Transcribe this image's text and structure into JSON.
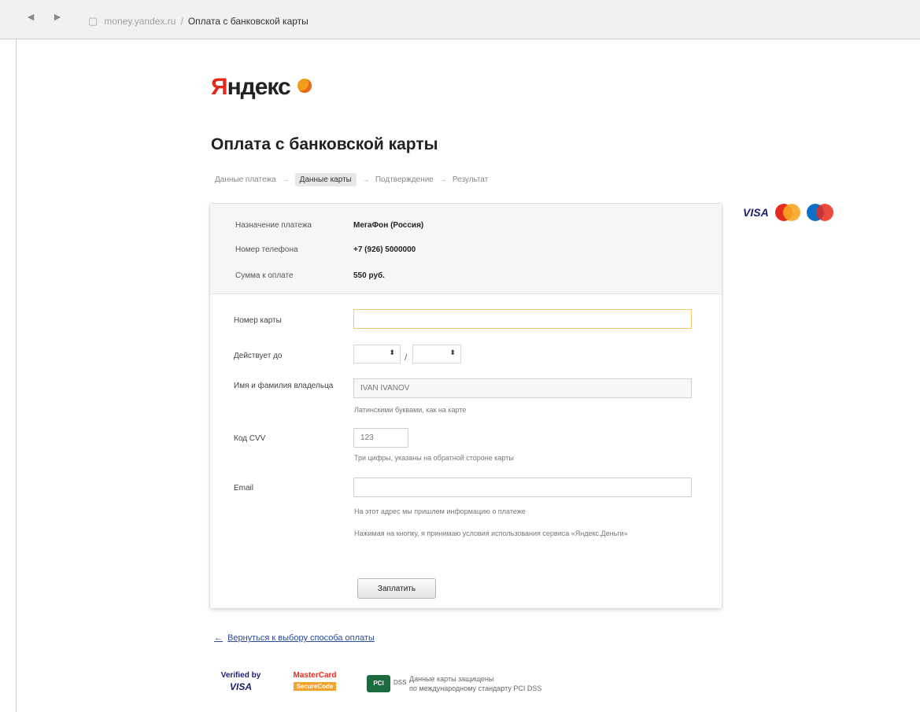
{
  "browser": {
    "back": "◄",
    "forward": "►",
    "page_icon": "▢",
    "host": "money.yandex.ru",
    "separator": "/",
    "tab_title": "Оплата с банковской карты"
  },
  "logo": {
    "y": "Я",
    "rest": "ндекс",
    "icon": "yandex-money-icon"
  },
  "title": "Оплата с банковской карты",
  "steps": [
    {
      "label": "Данные платежа",
      "active": false
    },
    {
      "label": "Данные карты",
      "active": true
    },
    {
      "label": "Подтверждение",
      "active": false
    },
    {
      "label": "Результат",
      "active": false
    }
  ],
  "step_arrow": "→",
  "card_brands": {
    "visa": "VISA",
    "mastercard": "mastercard-icon",
    "maestro": "maestro-icon"
  },
  "payment_info": [
    {
      "label": "Назначение платежа",
      "value": "МегаФон (Россия)"
    },
    {
      "label": "Номер телефона",
      "value": "+7 (926) 5000000"
    },
    {
      "label": "Сумма к оплате",
      "value": "550 руб."
    }
  ],
  "form": {
    "card_number": {
      "label": "Номер карты",
      "value": ""
    },
    "expiry": {
      "label": "Действует до",
      "month": "",
      "year": "",
      "slash": "/",
      "arrow": "⬍"
    },
    "holder": {
      "label": "Имя и фамилия владельца",
      "placeholder": "IVAN IVANOV",
      "hint": "Латинскими буквами, как на карте"
    },
    "cvv": {
      "label": "Код CVV",
      "placeholder": "123",
      "hint": "Три цифры, указаны на обратной стороне карты"
    },
    "email": {
      "label": "Email",
      "value": "",
      "hint": "На этот адрес мы пришлем информацию о платеже"
    },
    "notice": "Нажимая на кнопку, я принимаю условия использования сервиса «Яндекс.Деньги»",
    "submit": "Заплатить"
  },
  "back_link": {
    "arrow": "←",
    "label": "Вернуться к выбору способа оплаты"
  },
  "footer": {
    "vbv_top": "Verified by",
    "vbv_bottom": "VISA",
    "mc_top": "MasterCard",
    "mc_bottom": "SecureCode",
    "pci": "PCI",
    "pci_label": "DSS",
    "secure_line1": "Данные карты защищены",
    "secure_line2": "по международному стандарту PCI DSS"
  }
}
